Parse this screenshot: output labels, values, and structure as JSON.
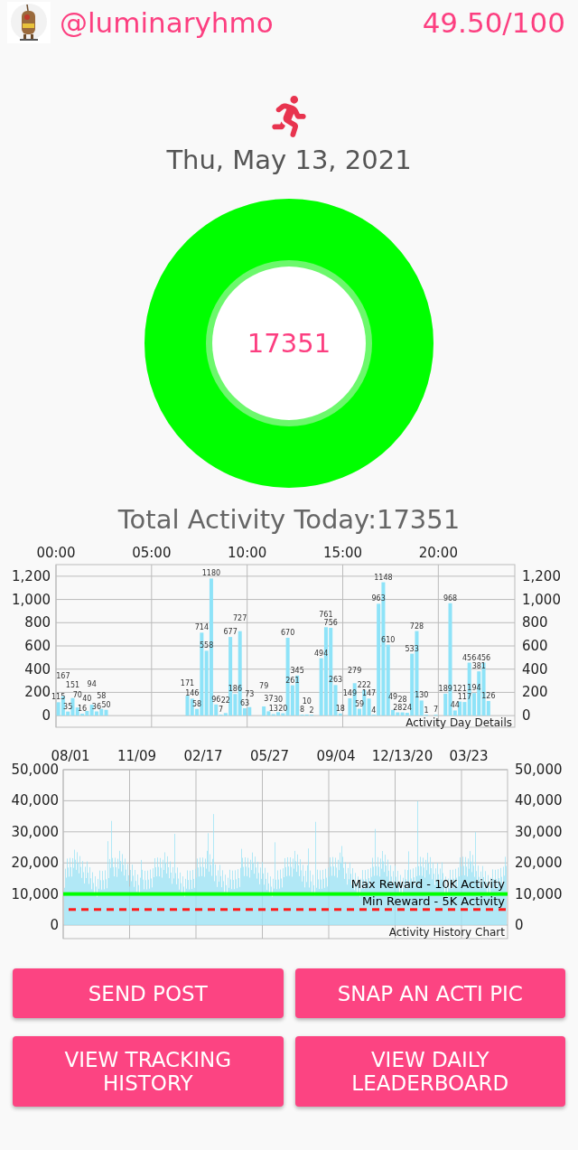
{
  "header": {
    "username": "@luminaryhmo",
    "score": "49.50/100"
  },
  "date": "Thu, May 13, 2021",
  "goal_ring": {
    "value": "17351",
    "level": 1
  },
  "total": "Total Activity Today:17351",
  "day_chart": {
    "chart_data": {
      "type": "bar",
      "title": "Activity Day Details",
      "color": "#8ee3f8",
      "x": [
        0,
        0.25,
        0.5,
        0.75,
        1,
        1.25,
        1.5,
        1.75,
        2,
        2.25,
        2.5,
        2.75,
        3,
        3.25,
        3.5,
        3.75,
        4,
        4.25,
        4.5,
        4.75,
        5,
        5.25,
        5.5,
        5.75,
        6,
        6.25,
        6.5,
        6.75,
        7,
        7.25,
        7.5,
        7.75,
        8,
        8.25,
        8.5,
        8.75,
        9,
        9.25,
        9.5,
        9.75,
        10,
        10.25,
        10.5,
        10.75,
        11,
        11.25,
        11.5,
        11.75,
        12,
        12.25,
        12.5,
        12.75,
        13,
        13.25,
        13.5,
        13.75,
        14,
        14.25,
        14.5,
        14.75,
        15,
        15.25,
        15.5,
        15.75,
        16,
        16.25,
        16.5,
        16.75,
        17,
        17.25,
        17.5,
        17.75,
        18,
        18.25,
        18.5,
        18.75,
        19,
        19.25,
        19.5,
        19.75,
        20,
        20.25,
        20.5,
        20.75,
        21,
        21.25,
        21.5,
        21.75,
        22,
        22.25,
        22.5,
        22.75,
        23,
        23.25,
        23.5,
        23.75
      ],
      "values": [
        115,
        167,
        35,
        151,
        70,
        16,
        40,
        94,
        36,
        58,
        50,
        0,
        0,
        0,
        0,
        0,
        0,
        0,
        0,
        0,
        0,
        0,
        0,
        0,
        0,
        0,
        0,
        171,
        146,
        58,
        714,
        558,
        1180,
        96,
        7,
        22,
        677,
        186,
        727,
        63,
        73,
        0,
        0,
        79,
        37,
        13,
        30,
        20,
        670,
        261,
        345,
        8,
        10,
        2,
        0,
        494,
        761,
        756,
        263,
        18,
        0,
        149,
        279,
        59,
        222,
        147,
        4,
        963,
        1148,
        610,
        49,
        28,
        28,
        24,
        533,
        728,
        130,
        1,
        0,
        7,
        0,
        189,
        968,
        44,
        121,
        117,
        456,
        194,
        381,
        456,
        126,
        0,
        0,
        0,
        0,
        0
      ],
      "xlim": [
        0,
        24
      ],
      "ylim": [
        -100,
        1300
      ],
      "xticks": [
        {
          "value": 0,
          "label": "00:00"
        },
        {
          "value": 5,
          "label": "05:00"
        },
        {
          "value": 10,
          "label": "10:00"
        },
        {
          "value": 15,
          "label": "15:00"
        },
        {
          "value": 20,
          "label": "20:00"
        }
      ],
      "yticks": [
        {
          "value": 0,
          "label": "0"
        },
        {
          "value": 200,
          "label": "200"
        },
        {
          "value": 400,
          "label": "400"
        },
        {
          "value": 600,
          "label": "600"
        },
        {
          "value": 800,
          "label": "800"
        },
        {
          "value": 1000,
          "label": "1,000"
        },
        {
          "value": 1200,
          "label": "1,200"
        }
      ],
      "value_labels": [
        "115",
        "167",
        "35",
        "151",
        "70",
        "16",
        "40",
        "94",
        "36",
        "58",
        "50",
        null,
        null,
        null,
        null,
        null,
        null,
        null,
        null,
        null,
        null,
        null,
        null,
        null,
        null,
        null,
        null,
        "171",
        "146",
        "58",
        "714",
        "558",
        "1180",
        "96",
        "7",
        "22",
        "677",
        "186",
        "727",
        "63",
        "73",
        null,
        null,
        "79",
        "37",
        "13",
        "30",
        "20",
        "670",
        "261",
        "345",
        "8",
        "10",
        "2",
        null,
        "494",
        "761",
        "756",
        "263",
        "18",
        null,
        "149",
        "279",
        "59",
        "222",
        "147",
        "4",
        "963",
        "1148",
        "610",
        "49",
        "28",
        "28",
        "24",
        "533",
        "728",
        "130",
        "1",
        null,
        "7",
        null,
        "189",
        "968",
        "44",
        "121",
        "117",
        "456",
        "194",
        "381",
        "456",
        "126",
        null,
        null,
        null,
        null,
        null
      ],
      "grid": true
    }
  },
  "history_chart": {
    "x_labels": [
      "08/01",
      "11/09",
      "02/17",
      "05/27",
      "09/04",
      "12/13/20",
      "03/23"
    ],
    "left_axis": [
      "50,000",
      "40,000",
      "30,000",
      "20,000",
      "10,000",
      "0"
    ],
    "right_axis": [
      "50,000",
      "40,000",
      "30,000",
      "20,000",
      "10,000",
      "0"
    ],
    "reward_lines": [
      {
        "label": "Max Reward - 10K Activity",
        "kind": "solid",
        "color": "#00ff00"
      },
      {
        "label": "Min Reward - 5K Activity",
        "kind": "dashed",
        "color": "#ff1a1a"
      }
    ],
    "caption": "Activity History Chart"
  },
  "buttons": [
    "SEND POST",
    "SNAP AN ACTI PIC",
    "VIEW TRACKING HISTORY",
    "VIEW DAILY LEADERBOARD"
  ]
}
